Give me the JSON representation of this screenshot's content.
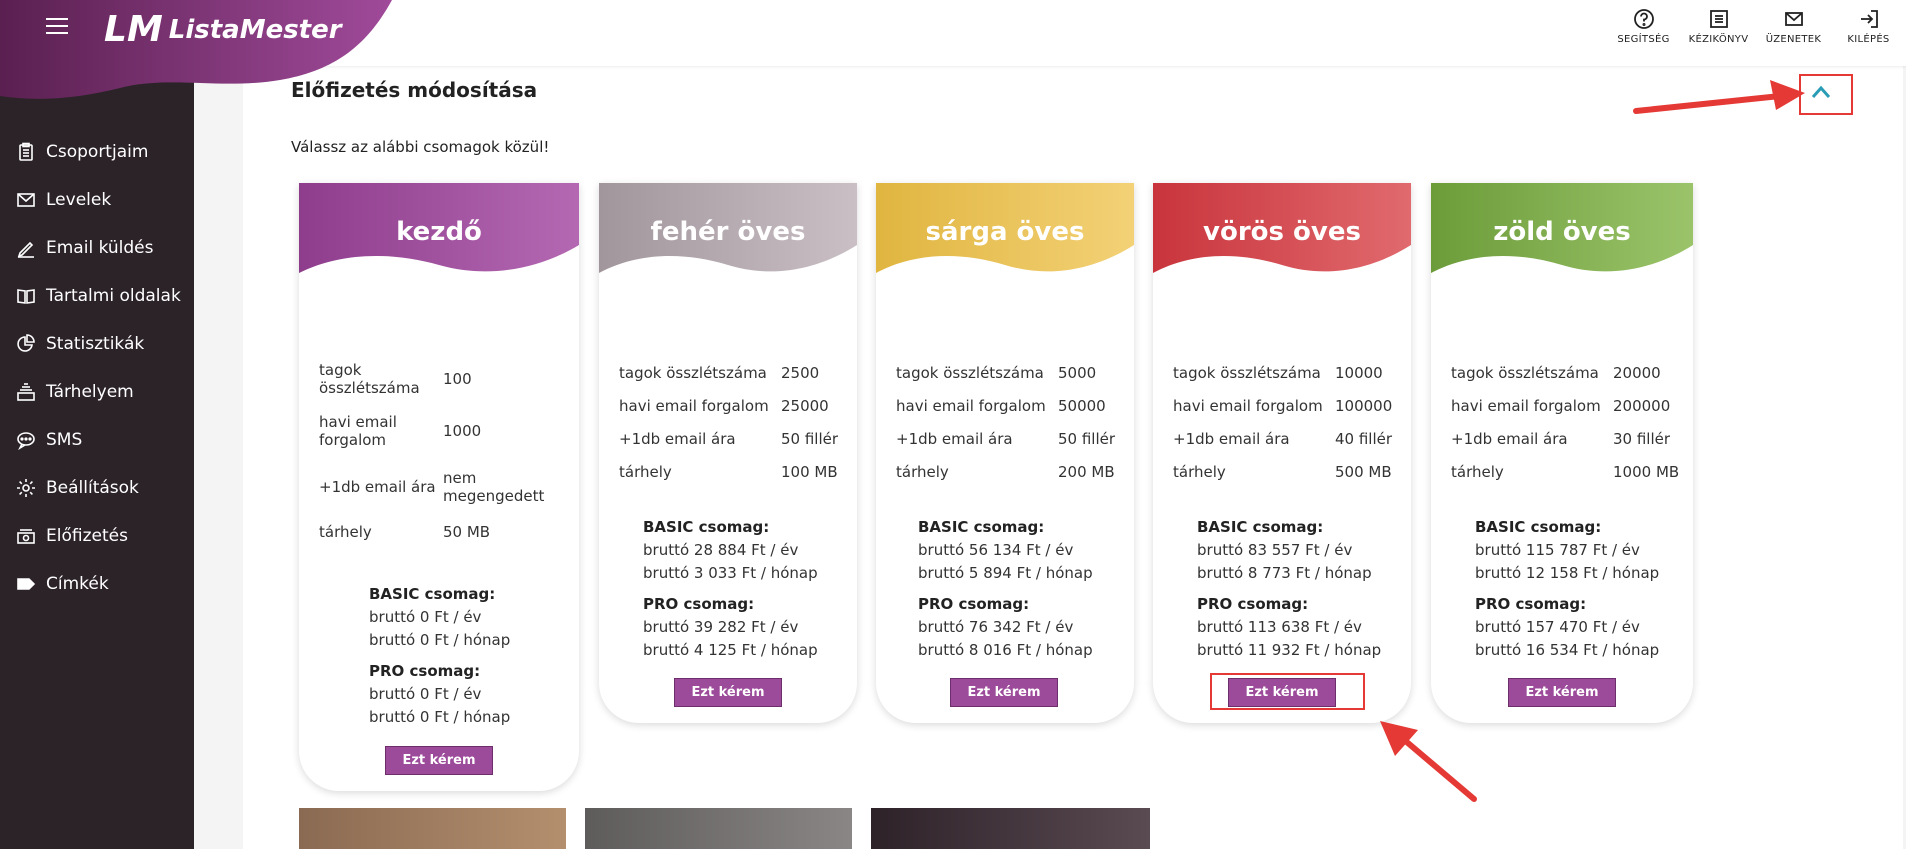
{
  "app": {
    "logo_mark": "LM",
    "logo_text": "ListaMester"
  },
  "sidebar": {
    "items": [
      {
        "label": "Csoportjaim",
        "icon": "clipboard-icon"
      },
      {
        "label": "Levelek",
        "icon": "mail-icon"
      },
      {
        "label": "Email küldés",
        "icon": "pen-icon"
      },
      {
        "label": "Tartalmi oldalak",
        "icon": "book-icon"
      },
      {
        "label": "Statisztikák",
        "icon": "pie-chart-icon"
      },
      {
        "label": "Tárhelyem",
        "icon": "storage-icon"
      },
      {
        "label": "SMS",
        "icon": "chat-icon"
      },
      {
        "label": "Beállítások",
        "icon": "gear-icon"
      },
      {
        "label": "Előfizetés",
        "icon": "money-icon"
      },
      {
        "label": "Címkék",
        "icon": "tag-icon"
      }
    ]
  },
  "topbar": {
    "help": "SEGÍTSÉG",
    "manual": "KÉZIKÖNYV",
    "messages": "ÜZENETEK",
    "logout": "KILÉPÉS"
  },
  "section": {
    "title": "Előfizetés módosítása",
    "subtitle": "Válassz az alábbi csomagok közül!"
  },
  "plans": [
    {
      "name": "kezdő",
      "color_a": "#8e3d8c",
      "color_b": "#b468b2",
      "specs": [
        {
          "key": "tagok összlétszáma",
          "val": "100"
        },
        {
          "key": "havi email forgalom",
          "val": "1000"
        },
        {
          "key": "+1db email ára",
          "val": "nem megengedett"
        },
        {
          "key": "tárhely",
          "val": "50 MB"
        }
      ],
      "basic_label": "BASIC csomag:",
      "basic_year": "bruttó 0 Ft / év",
      "basic_month": "bruttó 0 Ft / hónap",
      "pro_label": "PRO csomag:",
      "pro_year": "bruttó 0 Ft / év",
      "pro_month": "bruttó 0 Ft / hónap",
      "button": "Ezt kérem"
    },
    {
      "name": "fehér öves",
      "color_a": "#a1969c",
      "color_b": "#c9bfc4",
      "specs": [
        {
          "key": "tagok összlétszáma",
          "val": "2500"
        },
        {
          "key": "havi email forgalom",
          "val": "25000"
        },
        {
          "key": "+1db email ára",
          "val": "50 fillér"
        },
        {
          "key": "tárhely",
          "val": "100 MB"
        }
      ],
      "basic_label": "BASIC csomag:",
      "basic_year": "bruttó 28 884 Ft / év",
      "basic_month": "bruttó 3 033 Ft / hónap",
      "pro_label": "PRO csomag:",
      "pro_year": "bruttó 39 282 Ft / év",
      "pro_month": "bruttó 4 125 Ft / hónap",
      "button": "Ezt kérem"
    },
    {
      "name": "sárga öves",
      "color_a": "#e0b540",
      "color_b": "#f3d176",
      "specs": [
        {
          "key": "tagok összlétszáma",
          "val": "5000"
        },
        {
          "key": "havi email forgalom",
          "val": "50000"
        },
        {
          "key": "+1db email ára",
          "val": "50 fillér"
        },
        {
          "key": "tárhely",
          "val": "200 MB"
        }
      ],
      "basic_label": "BASIC csomag:",
      "basic_year": "bruttó 56 134 Ft / év",
      "basic_month": "bruttó 5 894 Ft / hónap",
      "pro_label": "PRO csomag:",
      "pro_year": "bruttó 76 342 Ft / év",
      "pro_month": "bruttó 8 016 Ft / hónap",
      "button": "Ezt kérem"
    },
    {
      "name": "vörös öves",
      "color_a": "#c9343c",
      "color_b": "#e06a6e",
      "specs": [
        {
          "key": "tagok összlétszáma",
          "val": "10000"
        },
        {
          "key": "havi email forgalom",
          "val": "100000"
        },
        {
          "key": "+1db email ára",
          "val": "40 fillér"
        },
        {
          "key": "tárhely",
          "val": "500 MB"
        }
      ],
      "basic_label": "BASIC csomag:",
      "basic_year": "bruttó 83 557 Ft / év",
      "basic_month": "bruttó 8 773 Ft / hónap",
      "pro_label": "PRO csomag:",
      "pro_year": "bruttó 113 638 Ft / év",
      "pro_month": "bruttó 11 932 Ft / hónap",
      "button": "Ezt kérem"
    },
    {
      "name": "zöld öves",
      "color_a": "#6c9c3a",
      "color_b": "#9bc46a",
      "specs": [
        {
          "key": "tagok összlétszáma",
          "val": "20000"
        },
        {
          "key": "havi email forgalom",
          "val": "200000"
        },
        {
          "key": "+1db email ára",
          "val": "30 fillér"
        },
        {
          "key": "tárhely",
          "val": "1000 MB"
        }
      ],
      "basic_label": "BASIC csomag:",
      "basic_year": "bruttó 115 787 Ft / év",
      "basic_month": "bruttó 12 158 Ft / hónap",
      "pro_label": "PRO csomag:",
      "pro_year": "bruttó 157 470 Ft / év",
      "pro_month": "bruttó 16 534 Ft / hónap",
      "button": "Ezt kérem"
    }
  ],
  "colors": {
    "sidebar_bg": "#2c2329",
    "brand_purple": "#8e3d8c",
    "accent_teal": "#2a9db6",
    "annotation_red": "#e53935",
    "button_purple": "#9c4a9a"
  }
}
